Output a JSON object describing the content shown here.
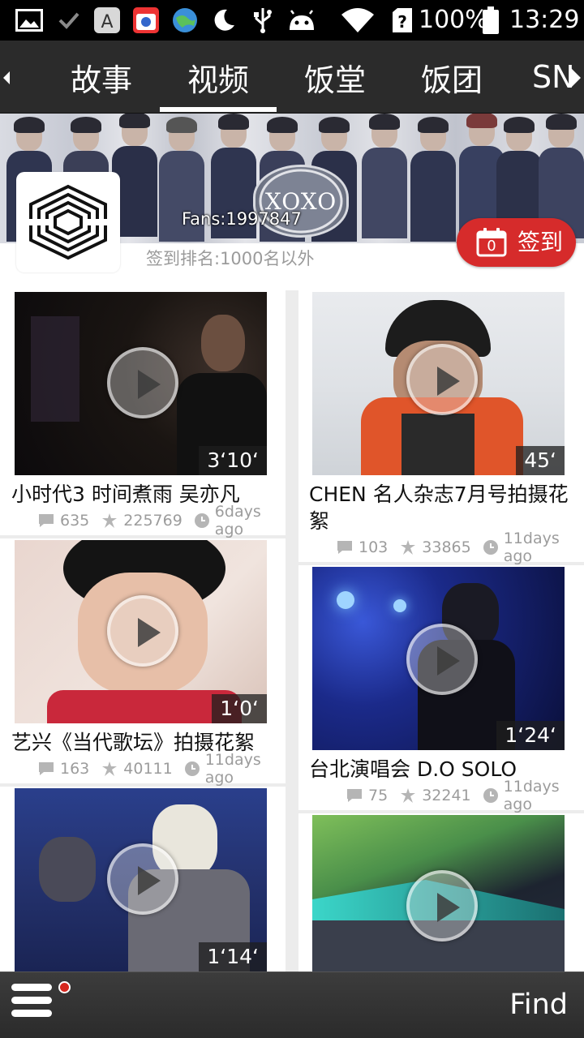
{
  "status_bar": {
    "battery_text": "100%",
    "time": "13:29"
  },
  "tabs": [
    {
      "label": "故事",
      "active": false
    },
    {
      "label": "视频",
      "active": true
    },
    {
      "label": "饭堂",
      "active": false
    },
    {
      "label": "饭团",
      "active": false
    },
    {
      "label": "SN",
      "active": false
    }
  ],
  "header": {
    "fans": "Fans:1997847",
    "rank": "签到排名:1000名以外",
    "checkin_label": "签到",
    "checkin_count": "0"
  },
  "videos": [
    {
      "title": "小时代3 时间煮雨 吴亦凡",
      "duration": "3‘10‘",
      "comments": "635",
      "likes": "225769",
      "time_ago": "6days ago"
    },
    {
      "title": "CHEN 名人杂志7月号拍摄花絮",
      "duration": "45‘",
      "comments": "103",
      "likes": "33865",
      "time_ago": "11days ago"
    },
    {
      "title": "艺兴《当代歌坛》拍摄花絮",
      "duration": "1‘0‘",
      "comments": "163",
      "likes": "40111",
      "time_ago": "11days ago"
    },
    {
      "title": "台北演唱会 D.O SOLO",
      "duration": "1‘24‘",
      "comments": "75",
      "likes": "32241",
      "time_ago": "11days ago"
    },
    {
      "title": "",
      "duration": "1‘14‘",
      "comments": "",
      "likes": "",
      "time_ago": ""
    },
    {
      "title": "",
      "duration": "",
      "comments": "",
      "likes": "",
      "time_ago": ""
    }
  ],
  "bottom_bar": {
    "find_label": "Find"
  },
  "icons": {
    "comment": "comment-icon",
    "like": "like-icon",
    "clock": "clock-icon",
    "menu": "menu-icon",
    "calendar": "calendar-icon"
  },
  "colors": {
    "accent_red": "#d62b2b",
    "tabbar_bg": "#2b2b2b",
    "meta_gray": "#9c9c9c"
  }
}
